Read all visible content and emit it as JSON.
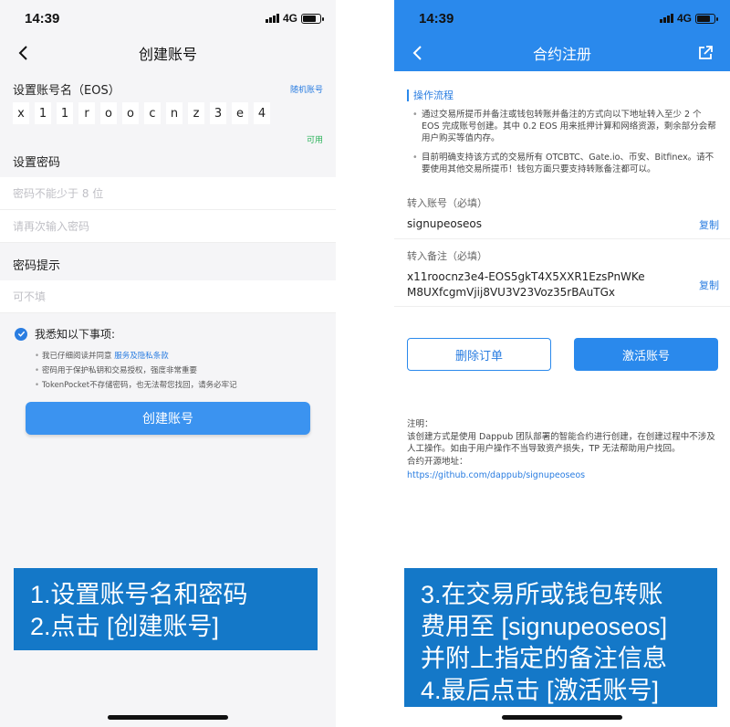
{
  "left": {
    "status": {
      "time": "14:39",
      "network": "4G"
    },
    "nav_title": "创建账号",
    "account_label": "设置账号名（EOS）",
    "random_link": "随机账号",
    "account_chars": [
      "x",
      "1",
      "1",
      "r",
      "o",
      "o",
      "c",
      "n",
      "z",
      "3",
      "e",
      "4"
    ],
    "available": "可用",
    "password_label": "设置密码",
    "password_placeholder": "密码不能少于 8 位",
    "password_confirm_placeholder": "请再次输入密码",
    "hint_label": "密码提示",
    "hint_placeholder": "可不填",
    "notice_title": "我悉知以下事项:",
    "notice_items": {
      "item1_prefix": "我已仔细阅读并同意",
      "item1_link": "服务及隐私条款",
      "item2": "密码用于保护私钥和交易授权，强度非常重要",
      "item3": "TokenPocket不存储密码，也无法帮您找回，请务必牢记"
    },
    "create_button": "创建账号"
  },
  "right": {
    "status": {
      "time": "14:39",
      "network": "4G"
    },
    "nav_title": "合约注册",
    "steps_title": "操作流程",
    "steps": [
      "通过交易所提币并备注或钱包转账并备注的方式向以下地址转入至少 2 个 EOS 完成账号创建。其中 0.2 EOS 用来抵押计算和网络资源，剩余部分会帮用户购买等值内存。",
      "目前明确支持该方式的交易所有 OTCBTC、Gate.io、币安、Bitfinex。请不要使用其他交易所提币！钱包方面只要支持转账备注都可以。"
    ],
    "transfer_account_label": "转入账号（必填）",
    "transfer_account_value": "signupeoseos",
    "copy": "复制",
    "memo_label": "转入备注（必填）",
    "memo_line1": "x11roocnz3e4-EOS5gkT4X5XXR1EzsPnWKe",
    "memo_line2": "M8UXfcgmVjij8VU3V23Voz35rBAuTGx",
    "delete_button": "删除订单",
    "activate_button": "激活账号",
    "note_title": "注明：",
    "note_text": "该创建方式是使用 Dappub 团队部署的智能合约进行创建，在创建过程中不涉及人工操作。如由于用户操作不当导致资产损失，TP 无法帮助用户找回。",
    "source_label": "合约开源地址：",
    "source_url": "https://github.com/dappub/signupeoseos"
  },
  "captions": {
    "left": [
      "1.设置账号名和密码",
      "2.点击 [创建账号]"
    ],
    "right": [
      "3.在交易所或钱包转账",
      "费用至 [signupeoseos]",
      "并附上指定的备注信息",
      "4.最后点击 [激活账号]"
    ]
  },
  "colors": {
    "accent": "#2a89ec",
    "caption_bg": "#1478c8",
    "available": "#2bb35a"
  }
}
